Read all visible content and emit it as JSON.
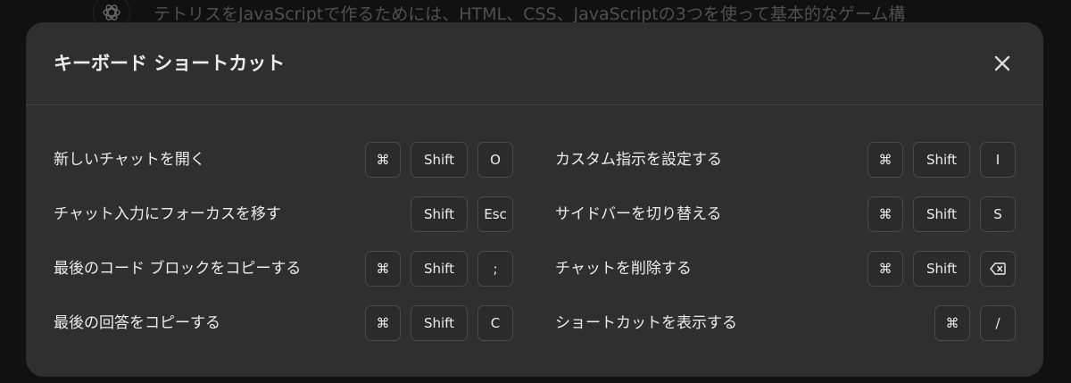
{
  "background": {
    "message_preview": "テトリスをJavaScriptで作るためには、HTML、CSS、JavaScriptの3つを使って基本的なゲーム構"
  },
  "modal": {
    "title": "キーボード ショートカット",
    "close_icon": "close-icon"
  },
  "shortcuts_left": [
    {
      "label": "新しいチャットを開く",
      "keys": [
        "⌘",
        "Shift",
        "O"
      ]
    },
    {
      "label": "チャット入力にフォーカスを移す",
      "keys": [
        "Shift",
        "Esc"
      ]
    },
    {
      "label": "最後のコード ブロックをコピーする",
      "keys": [
        "⌘",
        "Shift",
        ";"
      ]
    },
    {
      "label": "最後の回答をコピーする",
      "keys": [
        "⌘",
        "Shift",
        "C"
      ]
    }
  ],
  "shortcuts_right": [
    {
      "label": "カスタム指示を設定する",
      "keys": [
        "⌘",
        "Shift",
        "I"
      ]
    },
    {
      "label": "サイドバーを切り替える",
      "keys": [
        "⌘",
        "Shift",
        "S"
      ]
    },
    {
      "label": "チャットを削除する",
      "keys": [
        "⌘",
        "Shift",
        "backspace-icon"
      ]
    },
    {
      "label": "ショートカットを表示する",
      "keys": [
        "⌘",
        "/"
      ]
    }
  ],
  "colors": {
    "modal_bg": "#2f2f2f",
    "page_bg": "#111111",
    "text": "#ececec",
    "key_border": "#4a4a4a"
  }
}
